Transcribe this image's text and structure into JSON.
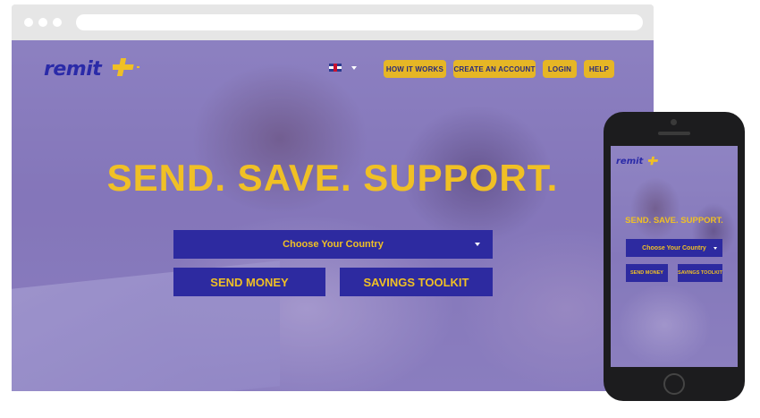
{
  "site": {
    "logo_text": "remit"
  },
  "nav": {
    "language_flag": "uk-flag-icon",
    "items": [
      {
        "label": "HOW IT WORKS"
      },
      {
        "label": "CREATE AN ACCOUNT"
      },
      {
        "label": "LOGIN"
      },
      {
        "label": "HELP"
      }
    ]
  },
  "hero": {
    "headline": "SEND. SAVE. SUPPORT.",
    "country_select": {
      "value": "Choose Your Country"
    },
    "buttons": [
      {
        "label": "SEND MONEY"
      },
      {
        "label": "SAVINGS TOOLKIT"
      }
    ]
  },
  "mobile": {
    "logo_text": "remit",
    "headline": "SEND. SAVE. SUPPORT.",
    "country_select": {
      "value": "Choose Your Country"
    },
    "buttons": [
      {
        "label": "SEND MONEY"
      },
      {
        "label": "SAVINGS TOOLKIT"
      }
    ]
  },
  "colors": {
    "brand_blue": "#2d2aa0",
    "accent_yellow": "#f0c025",
    "overlay_purple": "#6656b4"
  }
}
